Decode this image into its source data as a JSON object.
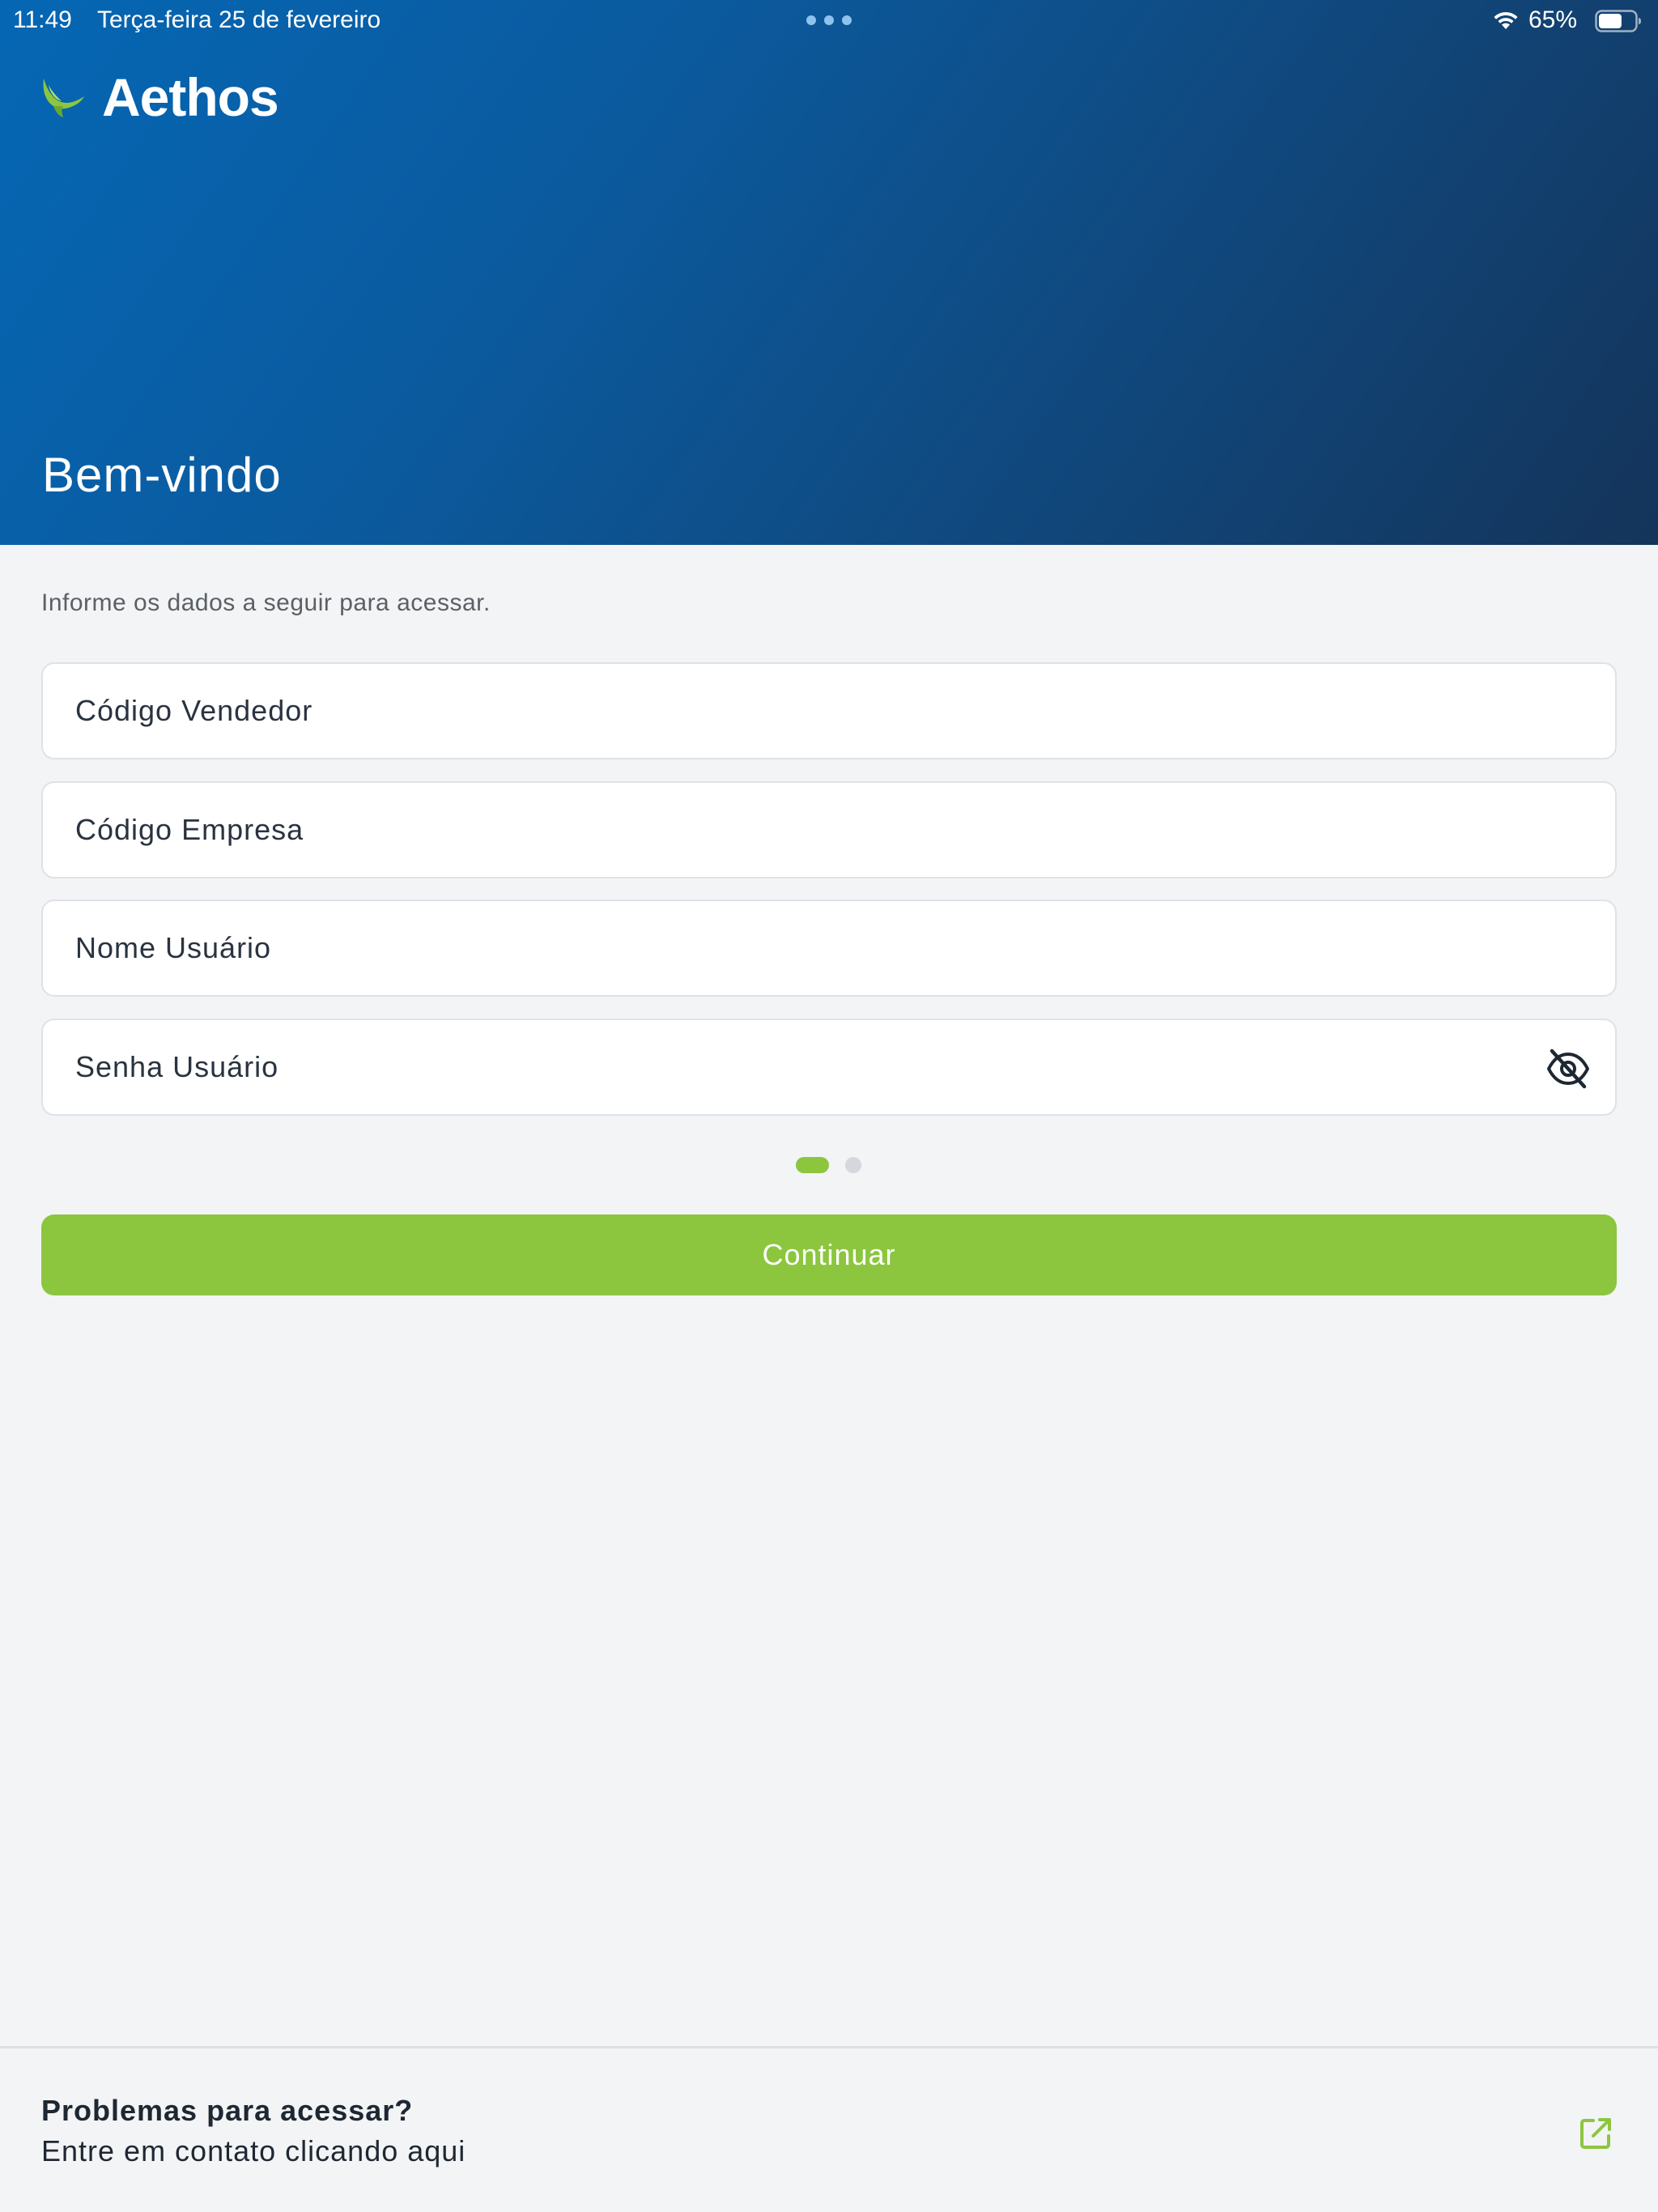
{
  "status_bar": {
    "time": "11:49",
    "date": "Terça-feira 25 de fevereiro",
    "battery": "65%",
    "battery_level": 0.65,
    "icons": [
      "multitask-dots-icon",
      "wifi-icon",
      "battery-icon"
    ]
  },
  "header": {
    "brand": "Aethos",
    "logo_icon": "bird-logo-icon",
    "title": "Bem-vindo"
  },
  "form": {
    "instructions": "Informe os dados a seguir para acessar.",
    "fields": {
      "vendor_code": {
        "placeholder": "Código Vendedor",
        "value": ""
      },
      "company_code": {
        "placeholder": "Código Empresa",
        "value": ""
      },
      "username": {
        "placeholder": "Nome Usuário",
        "value": ""
      },
      "password": {
        "placeholder": "Senha Usuário",
        "value": "",
        "toggle_icon": "eye-off-icon"
      }
    },
    "pager": {
      "total": 2,
      "active": 1
    },
    "continue_label": "Continuar"
  },
  "footer": {
    "title": "Problemas para acessar?",
    "subtitle": "Entre em contato clicando aqui",
    "icon": "external-link-icon"
  },
  "colors": {
    "header_start": "#0567b4",
    "header_end": "#14345a",
    "accent_green": "#8cc63f",
    "background": "#f3f4f6",
    "text_dark": "#1e2833"
  }
}
